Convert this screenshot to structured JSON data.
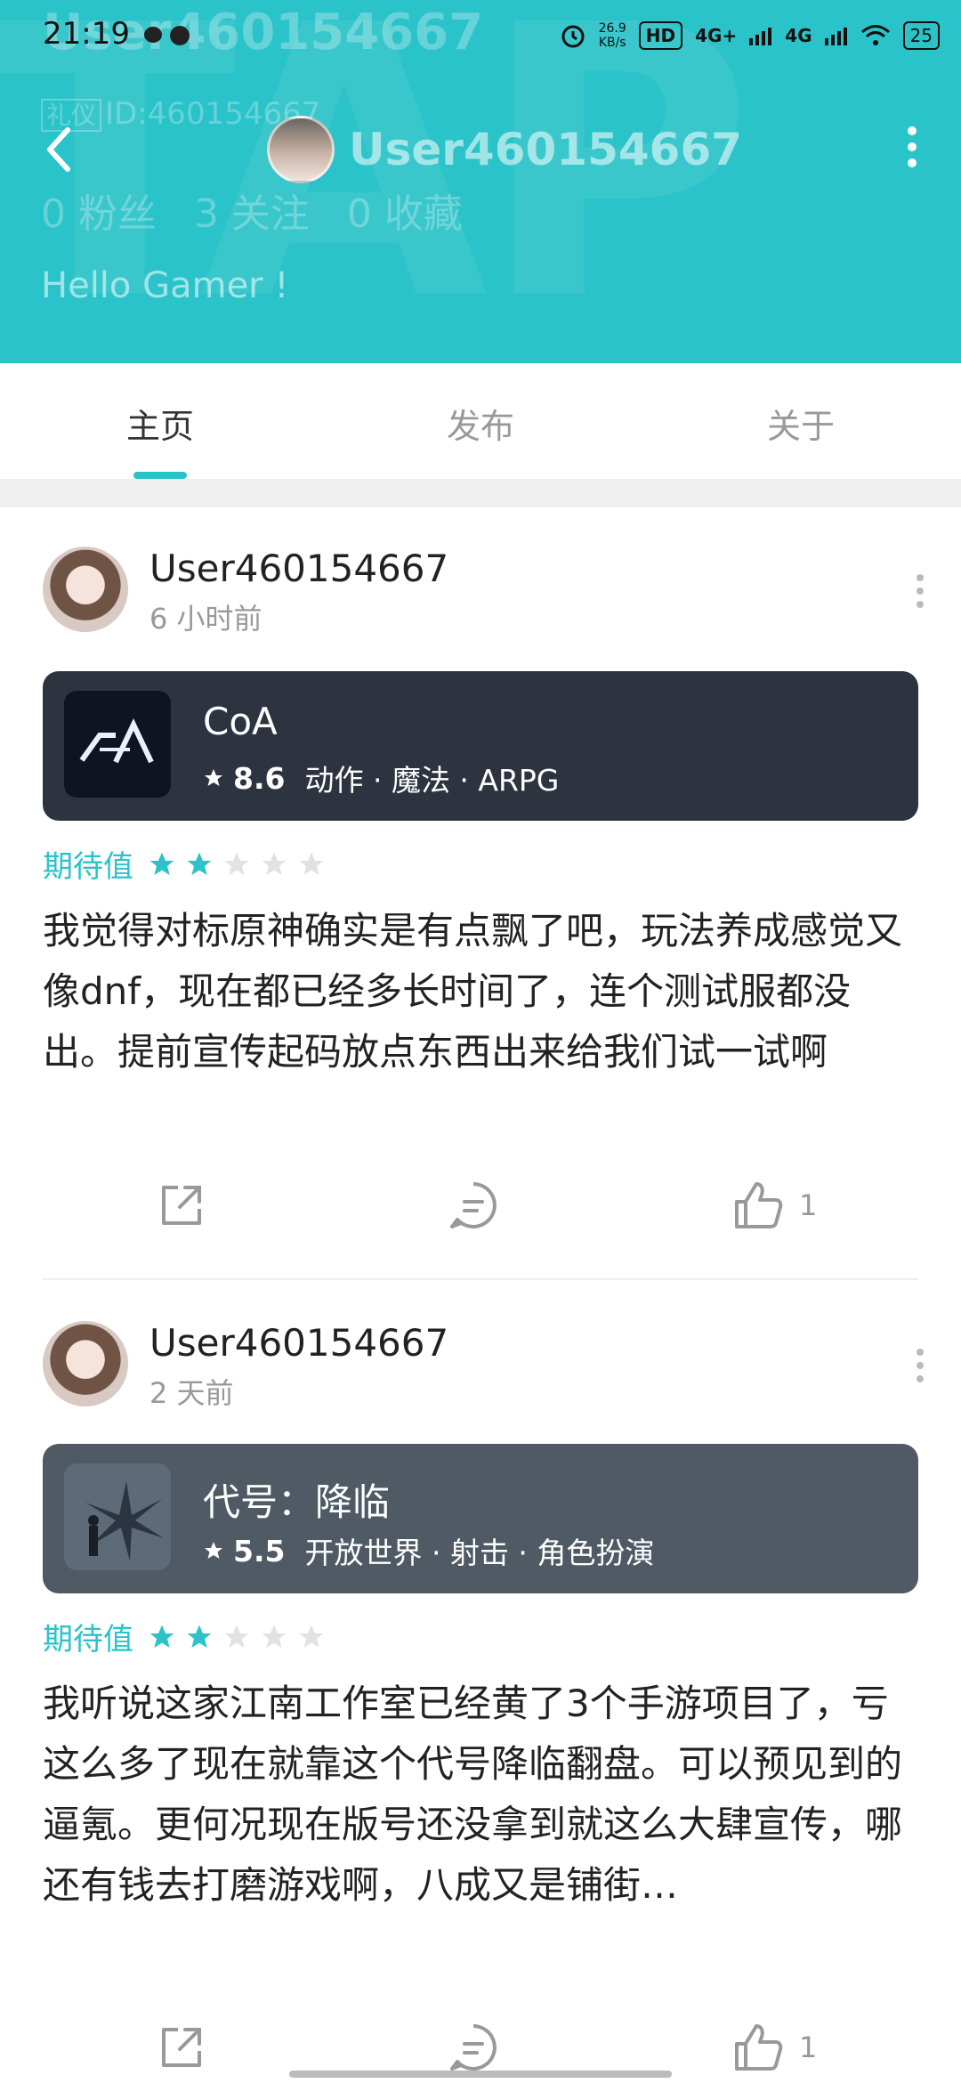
{
  "status_bar": {
    "time": "21:19",
    "speed": "26.9",
    "speed_unit": "KB/s",
    "hd": "HD",
    "net1": "4G+",
    "net2": "4G",
    "battery": "25"
  },
  "profile": {
    "name": "User460154667",
    "tag": "礼仪",
    "id_text": "ID:460154667",
    "stats": "0 粉丝   3 关注   0 收藏",
    "bio": "Hello Gamer !"
  },
  "nav": {
    "title": "User460154667"
  },
  "tabs": [
    {
      "label": "主页"
    },
    {
      "label": "发布"
    },
    {
      "label": "关于"
    }
  ],
  "colors": {
    "accent": "#2ac3c9",
    "card1": "#2e3340",
    "card2": "#4f5a64"
  },
  "posts": [
    {
      "user": "User460154667",
      "time": "6 小时前",
      "game": {
        "name": "CoA",
        "score": "8.6",
        "tags": "动作 · 魔法 · ARPG"
      },
      "expect_label": "期待值",
      "rating": 2,
      "body": "我觉得对标原神确实是有点飘了吧，玩法养成感觉又像dnf，现在都已经多长时间了，连个测试服都没出。提前宣传起码放点东西出来给我们试一试啊",
      "likes": "1"
    },
    {
      "user": "User460154667",
      "time": "2 天前",
      "game": {
        "name": "代号：降临",
        "score": "5.5",
        "tags": "开放世界 · 射击 · 角色扮演"
      },
      "expect_label": "期待值",
      "rating": 2,
      "body": "我听说这家江南工作室已经黄了3个手游项目了，亏这么多了现在就靠这个代号降临翻盘。可以预见到的逼氪。更何况现在版号还没拿到就这么大肆宣传，哪还有钱去打磨游戏啊，八成又是铺街…",
      "likes": "1"
    }
  ]
}
